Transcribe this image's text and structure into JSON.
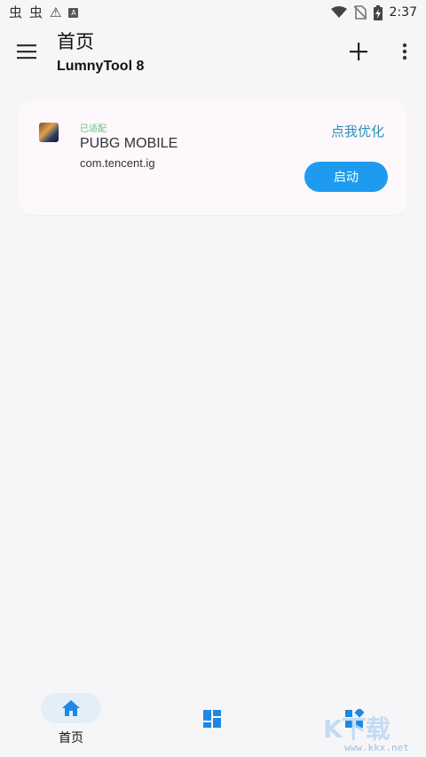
{
  "status_bar": {
    "left_icons": [
      "bug-icon",
      "bug-icon",
      "warning-icon",
      "a-badge-icon"
    ],
    "bug_glyph": "虫",
    "warning_glyph": "⚠",
    "a_glyph": "A",
    "right_icons": [
      "wifi-icon",
      "no-sim-icon",
      "battery-charging-icon"
    ],
    "time": "2:37"
  },
  "app_bar": {
    "title": "首页",
    "subtitle": "LumnyTool 8",
    "menu_icon": "menu-icon",
    "add_icon": "add-icon",
    "more_icon": "more-vert-icon"
  },
  "game_card": {
    "status": "已适配",
    "name": "PUBG MOBILE",
    "package": "com.tencent.ig",
    "optimize_label": "点我优化",
    "launch_label": "启动",
    "icon": "pubg-app-icon"
  },
  "bottom_nav": {
    "items": [
      {
        "label": "首页",
        "icon": "home-icon",
        "active": true
      },
      {
        "label": "",
        "icon": "dashboard-icon",
        "active": false
      },
      {
        "label": "",
        "icon": "widgets-icon",
        "active": false
      }
    ]
  },
  "watermark": {
    "logo": "K下载",
    "url": "www.kkx.net"
  },
  "colors": {
    "accent": "#1e9bef",
    "link": "#2e8fb8",
    "adapted_green": "#6cbf7e",
    "card_bg": "#fdf8fc",
    "page_bg": "#f6f6f8",
    "nav_active_pill": "#e3eef9"
  }
}
